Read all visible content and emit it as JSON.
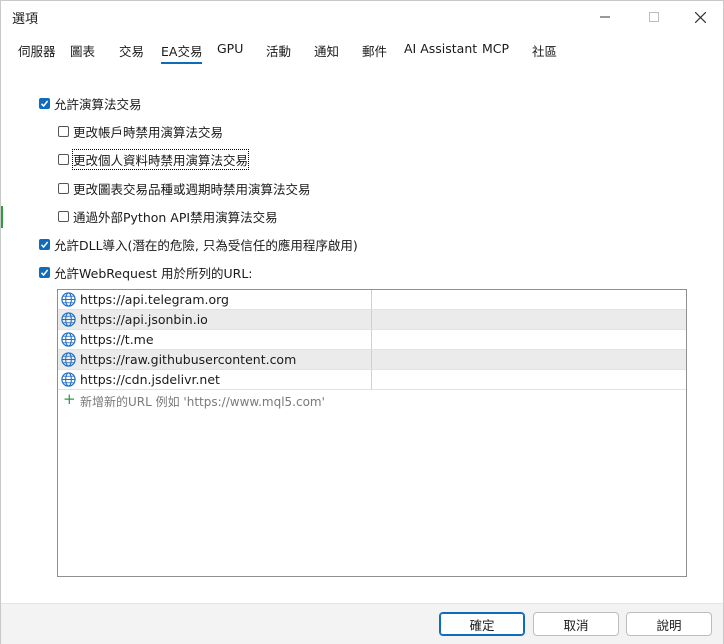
{
  "window": {
    "title": "選項"
  },
  "tabs": [
    {
      "label": "伺服器"
    },
    {
      "label": "圖表"
    },
    {
      "label": "交易"
    },
    {
      "label": "EA交易",
      "active": true
    },
    {
      "label": "GPU"
    },
    {
      "label": "活動"
    },
    {
      "label": "通知"
    },
    {
      "label": "郵件"
    },
    {
      "label": "AI Assistant"
    },
    {
      "label": "MCP"
    },
    {
      "label": "社區"
    }
  ],
  "options": {
    "allow_algo": {
      "label": "允許演算法交易",
      "checked": true
    },
    "disable_on_account_change": {
      "label": "更改帳戶時禁用演算法交易",
      "checked": false
    },
    "disable_on_profile_change": {
      "label": "更改個人資料時禁用演算法交易",
      "checked": false
    },
    "disable_on_symbol_change": {
      "label": "更改圖表交易品種或週期時禁用演算法交易",
      "checked": false
    },
    "disable_python_api": {
      "label": "通過外部Python API禁用演算法交易",
      "checked": false
    },
    "allow_dll": {
      "label": "允許DLL導入(潛在的危險, 只為受信任的應用程序啟用)",
      "checked": true
    },
    "allow_webrequest": {
      "label": "允許WebRequest 用於所列的URL:",
      "checked": true
    }
  },
  "url_list": {
    "urls": [
      "https://api.telegram.org",
      "https://api.jsonbin.io",
      "https://t.me",
      "https://raw.githubusercontent.com",
      "https://cdn.jsdelivr.net"
    ],
    "add_hint": "新增新的URL 例如 'https://www.mql5.com'"
  },
  "buttons": {
    "ok": "確定",
    "cancel": "取消",
    "help": "說明"
  },
  "colors": {
    "accent": "#0f6cbd",
    "add_icon": "#2e9b3e",
    "row_alt": "#ebebeb"
  }
}
